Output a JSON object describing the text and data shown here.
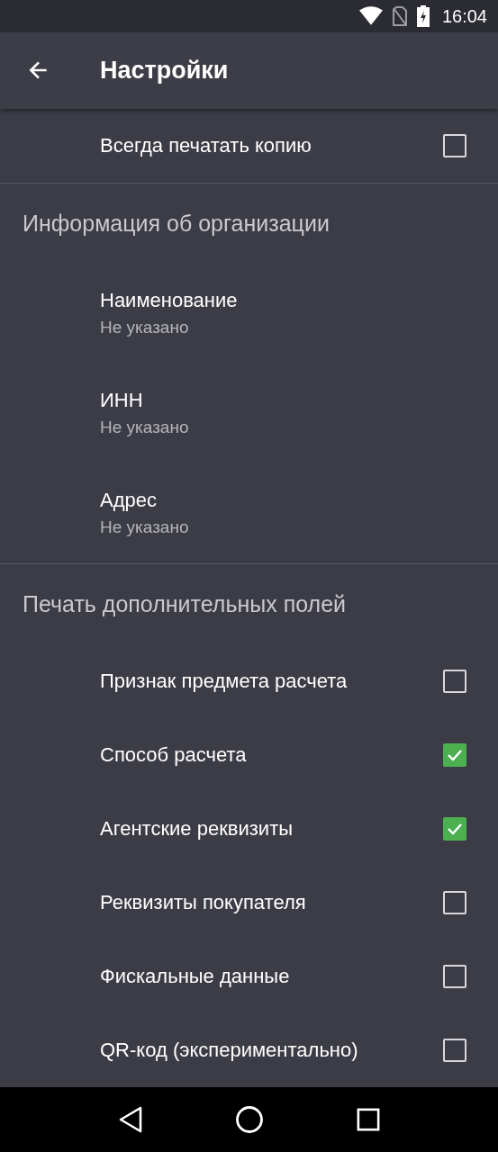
{
  "status_bar": {
    "time": "16:04"
  },
  "app_bar": {
    "title": "Настройки"
  },
  "top_items": [
    {
      "label": "Всегда печатать копию",
      "checked": false
    }
  ],
  "sections": [
    {
      "title": "Информация об организации",
      "items": [
        {
          "kind": "text",
          "label": "Наименование",
          "summary": "Не указано"
        },
        {
          "kind": "text",
          "label": "ИНН",
          "summary": "Не указано"
        },
        {
          "kind": "text",
          "label": "Адрес",
          "summary": "Не указано"
        }
      ]
    },
    {
      "title": "Печать дополнительных полей",
      "items": [
        {
          "kind": "checkbox",
          "label": "Признак предмета расчета",
          "checked": false
        },
        {
          "kind": "checkbox",
          "label": "Способ расчета",
          "checked": true
        },
        {
          "kind": "checkbox",
          "label": "Агентские реквизиты",
          "checked": true
        },
        {
          "kind": "checkbox",
          "label": "Реквизиты покупателя",
          "checked": false
        },
        {
          "kind": "checkbox",
          "label": "Фискальные данные",
          "checked": false
        },
        {
          "kind": "checkbox",
          "label": "QR-код (экспериментально)",
          "checked": false
        }
      ]
    }
  ]
}
